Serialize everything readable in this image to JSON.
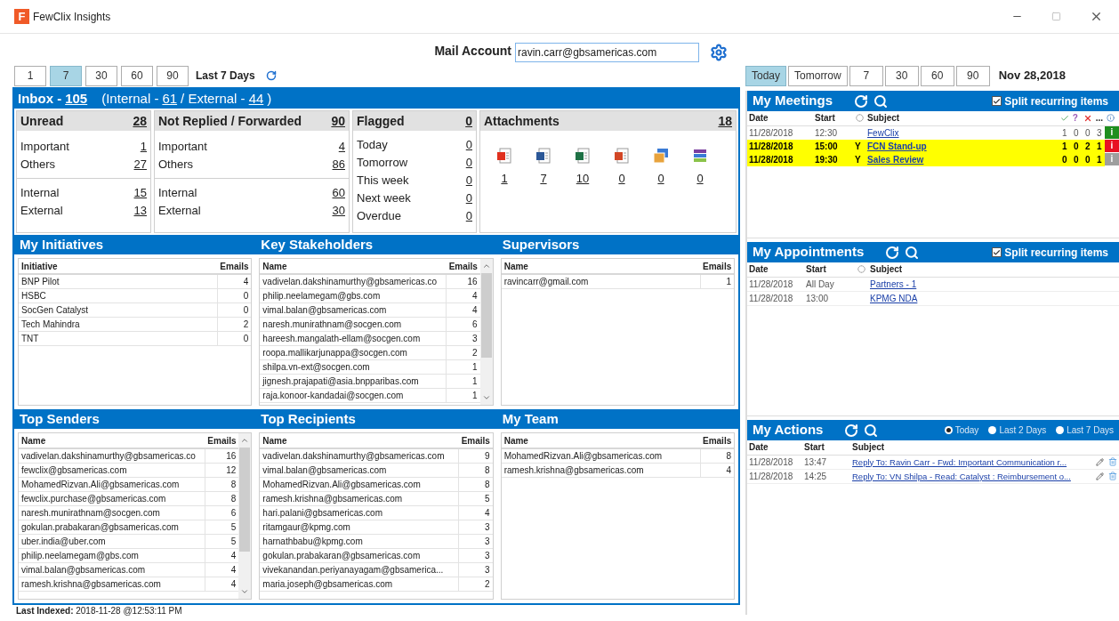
{
  "window": {
    "logo": "F",
    "title": "FewClix Insights"
  },
  "mail_account": {
    "label": "Mail Account",
    "value": "ravin.carr@gbsamericas.com"
  },
  "period": {
    "buttons": [
      {
        "label": "1",
        "selected": false
      },
      {
        "label": "7",
        "selected": true
      },
      {
        "label": "30",
        "selected": false
      },
      {
        "label": "60",
        "selected": false
      },
      {
        "label": "90",
        "selected": false
      }
    ],
    "caption": "Last 7 Days"
  },
  "inbox": {
    "title": "Inbox -",
    "total": "105",
    "open": "(Internal -",
    "internal": "61",
    "middle": "/ External -",
    "external": "44",
    "close": ")"
  },
  "cards": [
    {
      "kind": "counts",
      "title": "Unread",
      "total": "28",
      "groups": [
        [
          {
            "label": "Important",
            "value": "1"
          },
          {
            "label": "Others",
            "value": "27"
          }
        ],
        [
          {
            "label": "Internal",
            "value": "15"
          },
          {
            "label": "External",
            "value": "13"
          }
        ]
      ]
    },
    {
      "kind": "counts",
      "title": "Not Replied / Forwarded",
      "total": "90",
      "groups": [
        [
          {
            "label": "Important",
            "value": "4"
          },
          {
            "label": "Others",
            "value": "86"
          }
        ],
        [
          {
            "label": "Internal",
            "value": "60"
          },
          {
            "label": "External",
            "value": "30"
          }
        ]
      ]
    },
    {
      "kind": "counts",
      "title": "Flagged",
      "total": "0",
      "groups": [
        [
          {
            "label": "Today",
            "value": "0"
          },
          {
            "label": "Tomorrow",
            "value": "0"
          },
          {
            "label": "This week",
            "value": "0"
          },
          {
            "label": "Next week",
            "value": "0"
          },
          {
            "label": "Overdue",
            "value": "0"
          }
        ]
      ]
    },
    {
      "kind": "attachments",
      "title": "Attachments",
      "total": "18",
      "items": [
        {
          "kind": "pdf",
          "count": "1"
        },
        {
          "kind": "word",
          "count": "7"
        },
        {
          "kind": "excel",
          "count": "10"
        },
        {
          "kind": "powerpoint",
          "count": "0"
        },
        {
          "kind": "image",
          "count": "0"
        },
        {
          "kind": "archive",
          "count": "0"
        }
      ]
    }
  ],
  "sections": [
    {
      "panels": [
        {
          "title": "My Initiatives",
          "scrollable": false,
          "columns": [
            "Initiative",
            "Emails"
          ],
          "rows": [
            [
              "BNP Pilot",
              "4"
            ],
            [
              "HSBC",
              "0"
            ],
            [
              "SocGen Catalyst",
              "0"
            ],
            [
              "Tech Mahindra",
              "2"
            ],
            [
              "TNT",
              "0"
            ]
          ]
        },
        {
          "title": "Key Stakeholders",
          "scrollable": true,
          "columns": [
            "Name",
            "Emails"
          ],
          "rows": [
            [
              "vadivelan.dakshinamurthy@gbsamericas.co",
              "16"
            ],
            [
              "philip.neelamegam@gbs.com",
              "4"
            ],
            [
              "vimal.balan@gbsamericas.com",
              "4"
            ],
            [
              "naresh.munirathnam@socgen.com",
              "6"
            ],
            [
              "hareesh.mangalath-ellam@socgen.com",
              "3"
            ],
            [
              "roopa.mallikarjunappa@socgen.com",
              "2"
            ],
            [
              "shilpa.vn-ext@socgen.com",
              "1"
            ],
            [
              "jignesh.prajapati@asia.bnpparibas.com",
              "1"
            ],
            [
              "raja.konoor-kandadai@socgen.com",
              "1"
            ]
          ]
        },
        {
          "title": "Supervisors",
          "scrollable": false,
          "columns": [
            "Name",
            "Emails"
          ],
          "rows": [
            [
              "ravincarr@gmail.com",
              "1"
            ]
          ]
        }
      ]
    },
    {
      "panels": [
        {
          "title": "Top Senders",
          "scrollable": true,
          "columns": [
            "Name",
            "Emails"
          ],
          "rows": [
            [
              "vadivelan.dakshinamurthy@gbsamericas.co",
              "16"
            ],
            [
              "fewclix@gbsamericas.com",
              "12"
            ],
            [
              "MohamedRizvan.Ali@gbsamericas.com",
              "8"
            ],
            [
              "fewclix.purchase@gbsamericas.com",
              "8"
            ],
            [
              "naresh.munirathnam@socgen.com",
              "6"
            ],
            [
              "gokulan.prabakaran@gbsamericas.com",
              "5"
            ],
            [
              "uber.india@uber.com",
              "5"
            ],
            [
              "philip.neelamegam@gbs.com",
              "4"
            ],
            [
              "vimal.balan@gbsamericas.com",
              "4"
            ],
            [
              "ramesh.krishna@gbsamericas.com",
              "4"
            ]
          ]
        },
        {
          "title": "Top Recipients",
          "scrollable": false,
          "columns": [
            "Name",
            "Emails"
          ],
          "rows": [
            [
              "vadivelan.dakshinamurthy@gbsamericas.com",
              "9"
            ],
            [
              "vimal.balan@gbsamericas.com",
              "8"
            ],
            [
              "MohamedRizvan.Ali@gbsamericas.com",
              "8"
            ],
            [
              "ramesh.krishna@gbsamericas.com",
              "5"
            ],
            [
              "hari.palani@gbsamericas.com",
              "4"
            ],
            [
              "ritamgaur@kpmg.com",
              "3"
            ],
            [
              "harnathbabu@kpmg.com",
              "3"
            ],
            [
              "gokulan.prabakaran@gbsamericas.com",
              "3"
            ],
            [
              "vivekanandan.periyanayagam@gbsamerica...",
              "3"
            ],
            [
              "maria.joseph@gbsamericas.com",
              "2"
            ]
          ]
        },
        {
          "title": "My Team",
          "scrollable": false,
          "columns": [
            "Name",
            "Emails"
          ],
          "rows": [
            [
              "MohamedRizvan.Ali@gbsamericas.com",
              "8"
            ],
            [
              "ramesh.krishna@gbsamericas.com",
              "4"
            ]
          ]
        }
      ]
    }
  ],
  "calendar": {
    "buttons": [
      {
        "label": "Today",
        "selected": true
      },
      {
        "label": "Tomorrow",
        "selected": false
      },
      {
        "label": "7",
        "selected": false
      },
      {
        "label": "30",
        "selected": false
      },
      {
        "label": "60",
        "selected": false
      },
      {
        "label": "90",
        "selected": false
      }
    ],
    "date": "Nov 28,2018"
  },
  "meetings": {
    "title": "My Meetings",
    "split": {
      "label": "Split recurring items",
      "checked": true
    },
    "columns": [
      {
        "kind": "text",
        "label": "Date"
      },
      {
        "kind": "text",
        "label": "Start"
      },
      {
        "kind": "recurrence"
      },
      {
        "kind": "text",
        "label": "Subject"
      },
      {
        "kind": "accepted"
      },
      {
        "kind": "tentative",
        "label": "?"
      },
      {
        "kind": "declined"
      },
      {
        "kind": "pending",
        "label": "..."
      },
      {
        "kind": "info"
      }
    ],
    "rows": [
      {
        "date": "11/28/2018",
        "start": "12:30",
        "subject": "FewClix",
        "counts": [
          "1",
          "0",
          "0",
          "3"
        ],
        "highlighted": false,
        "status": "i",
        "color": "#1e8e1e"
      },
      {
        "date": "11/28/2018",
        "start": "15:00",
        "recurring": "Y",
        "subject": "FCN Stand-up",
        "counts": [
          "1",
          "0",
          "2",
          "1"
        ],
        "highlighted": true,
        "status": "i",
        "color": "#e81123"
      },
      {
        "date": "11/28/2018",
        "start": "19:30",
        "recurring": "Y",
        "subject": "Sales Review",
        "counts": [
          "0",
          "0",
          "0",
          "1"
        ],
        "highlighted": true,
        "status": "i",
        "color": "#9e9e9e"
      }
    ]
  },
  "appointments": {
    "title": "My Appointments",
    "split": {
      "label": "Split recurring items",
      "checked": true
    },
    "columns": [
      {
        "kind": "text",
        "label": "Date"
      },
      {
        "kind": "text",
        "label": "Start"
      },
      {
        "kind": "recurrence"
      },
      {
        "kind": "text",
        "label": "Subject"
      }
    ],
    "rows": [
      {
        "date": "11/28/2018",
        "start": "All Day",
        "subject": "Partners - 1"
      },
      {
        "date": "11/28/2018",
        "start": "13:00",
        "subject": "KPMG NDA"
      }
    ]
  },
  "actions": {
    "title": "My Actions",
    "filters": [
      {
        "label": "Today",
        "selected": true
      },
      {
        "label": "Last 2 Days",
        "selected": false
      },
      {
        "label": "Last 7 Days",
        "selected": false
      }
    ],
    "columns": [
      "Date",
      "Start",
      "Subject"
    ],
    "rows": [
      {
        "date": "11/28/2018",
        "start": "13:47",
        "subject": "Reply To: Ravin Carr - Fwd: Important Communication r..."
      },
      {
        "date": "11/28/2018",
        "start": "14:25",
        "subject": "Reply To: VN Shilpa - Read: Catalyst : Reimbursement o..."
      }
    ]
  },
  "status_bar": "**Last Indexed:** 2018-11-28 @12:53:11 PM"
}
